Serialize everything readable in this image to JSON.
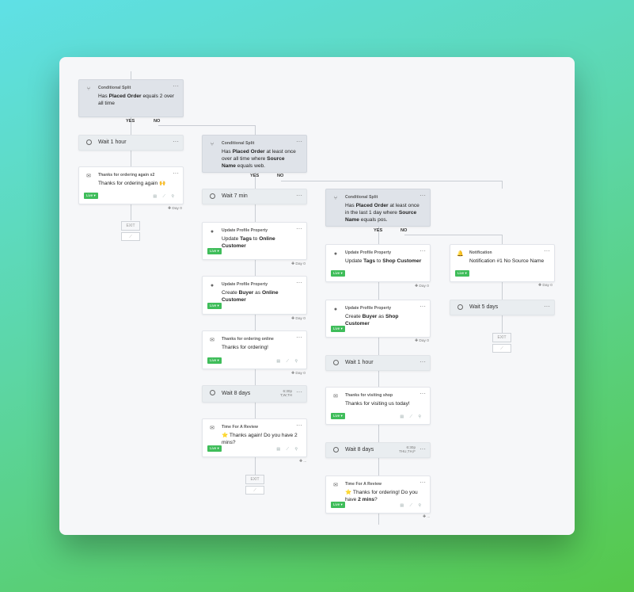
{
  "col1": {
    "split": {
      "title": "Conditional Split",
      "pre": "Has ",
      "bold1": "Placed Order",
      "post": " equals 2 over all time"
    },
    "yes": "YES",
    "no": "NO",
    "wait": "Wait 1 hour",
    "email": {
      "title": "Thanks for ordering again x2",
      "body": "Thanks for ordering again 🙌",
      "status": "Live ▾",
      "day": "✚ Day 0"
    },
    "exit": "EXIT"
  },
  "col2": {
    "split": {
      "title": "Conditional Split",
      "pre": "Has ",
      "bold1": "Placed Order",
      "mid": " at least once over all time where ",
      "bold2": "Source Name",
      "post": " equals web."
    },
    "yes": "YES",
    "no": "NO",
    "wait1": "Wait 7 min",
    "update1": {
      "title": "Update Profile Property",
      "pre": "Update ",
      "bold1": "Tags",
      "mid": " to ",
      "bold2": "Online Customer",
      "status": "Live ▾",
      "day": "✚ Day 0"
    },
    "update2": {
      "title": "Update Profile Property",
      "pre": "Create ",
      "bold1": "Buyer",
      "mid": " as ",
      "bold2": "Online Customer",
      "status": "Live ▾",
      "day": "✚ Day 0"
    },
    "email1": {
      "title": "Thanks for ordering online",
      "body": "Thanks for ordering!",
      "status": "Live ▾",
      "day": "✚ Day 0"
    },
    "wait2": {
      "label": "Wait 8 days",
      "time": "6:30p",
      "days": "T,W,TH"
    },
    "email2": {
      "title": "Time For A Review",
      "body": "⭐ Thanks again! Do you have 2 mins?",
      "status": "Live ▾",
      "day": "✚ ..."
    },
    "exit": "EXIT"
  },
  "col3": {
    "split": {
      "title": "Conditional Split",
      "pre": "Has ",
      "bold1": "Placed Order",
      "mid": " at least once in the last 1 day where ",
      "bold2": "Source Name",
      "post": " equals pos."
    },
    "yes": "YES",
    "no": "NO",
    "update1": {
      "title": "Update Profile Property",
      "pre": "Update ",
      "bold1": "Tags",
      "mid": " to ",
      "bold2": "Shop Customer",
      "status": "Live ▾",
      "day": "✚ Day 0"
    },
    "update2": {
      "title": "Update Profile Property",
      "pre": "Create ",
      "bold1": "Buyer",
      "mid": " as ",
      "bold2": "Shop Customer",
      "status": "Live ▾",
      "day": "✚ Day 0"
    },
    "wait1": "Wait 1 hour",
    "email1": {
      "title": "Thanks for visiting shop",
      "body": "Thanks for visiting us today!",
      "status": "Live ▾"
    },
    "wait2": {
      "label": "Wait 8 days",
      "time": "6:30p",
      "days": "THU,TH,F"
    },
    "email2": {
      "title": "Time For A Review",
      "pre": "⭐ Thanks for ordering! Do you have ",
      "bold1": "2 mins",
      "post": "?",
      "status": "Live ▾",
      "day": "✚ ..."
    }
  },
  "col4": {
    "notif": {
      "title": "Notification",
      "body": "Notification #1 No Source Name",
      "status": "Live ▾",
      "day": "✚ Day 0"
    },
    "wait": "Wait 5 days",
    "exit": "EXIT"
  },
  "common": {
    "more": "···",
    "meta_icons": "▤ ⟋ ⚲"
  }
}
